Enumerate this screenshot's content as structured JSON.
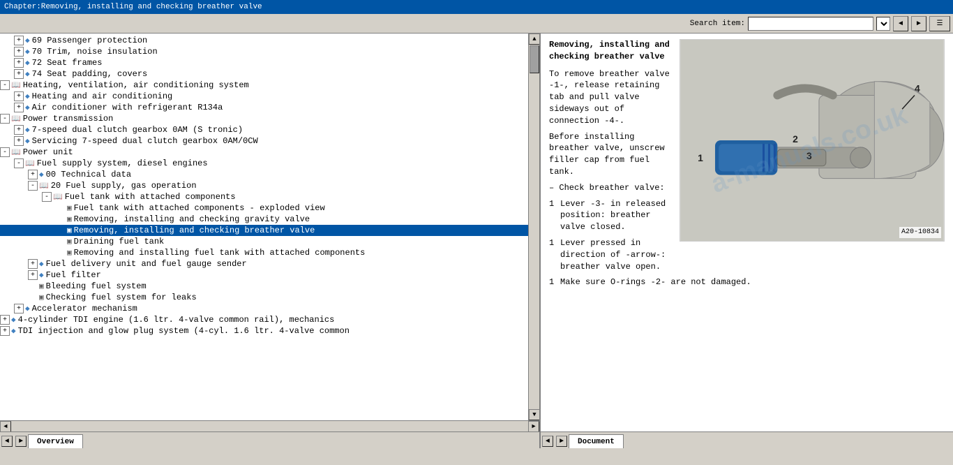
{
  "titleBar": {
    "text": "Chapter:Removing, installing and checking breather valve"
  },
  "toolbar": {
    "searchLabel": "Search item:",
    "searchPlaceholder": ""
  },
  "tabs": {
    "left": {
      "overview": "Overview",
      "nav_prev": "◄",
      "nav_next": "►"
    },
    "right": {
      "document": "Document",
      "nav_prev": "◄",
      "nav_next": "►"
    }
  },
  "tree": {
    "items": [
      {
        "id": 1,
        "indent": "indent1",
        "type": "expandable",
        "icon": "diamond",
        "text": "69 Passenger protection",
        "expanded": true
      },
      {
        "id": 2,
        "indent": "indent1",
        "type": "expandable",
        "icon": "diamond",
        "text": "70 Trim, noise insulation",
        "expanded": true
      },
      {
        "id": 3,
        "indent": "indent1",
        "type": "expandable",
        "icon": "diamond",
        "text": "72 Seat frames",
        "expanded": true
      },
      {
        "id": 4,
        "indent": "indent1",
        "type": "expandable",
        "icon": "diamond",
        "text": "74 Seat padding, covers",
        "expanded": true
      },
      {
        "id": 5,
        "indent": "indent0",
        "type": "expandable-open",
        "icon": "book",
        "text": "Heating, ventilation, air conditioning system",
        "expanded": true
      },
      {
        "id": 6,
        "indent": "indent1",
        "type": "expandable",
        "icon": "diamond",
        "text": "Heating and air conditioning",
        "expanded": true
      },
      {
        "id": 7,
        "indent": "indent1",
        "type": "expandable",
        "icon": "diamond",
        "text": "Air conditioner with refrigerant R134a",
        "expanded": true
      },
      {
        "id": 8,
        "indent": "indent0",
        "type": "expandable-open",
        "icon": "book",
        "text": "Power transmission",
        "expanded": true
      },
      {
        "id": 9,
        "indent": "indent1",
        "type": "expandable",
        "icon": "diamond",
        "text": "7-speed dual clutch gearbox 0AM (S tronic)",
        "expanded": true
      },
      {
        "id": 10,
        "indent": "indent1",
        "type": "expandable",
        "icon": "diamond",
        "text": "Servicing 7-speed dual clutch gearbox 0AM/0CW",
        "expanded": true
      },
      {
        "id": 11,
        "indent": "indent0",
        "type": "expandable-open",
        "icon": "book",
        "text": "Power unit",
        "expanded": true
      },
      {
        "id": 12,
        "indent": "indent1",
        "type": "expandable-open",
        "icon": "book",
        "text": "Fuel supply system, diesel engines",
        "expanded": true
      },
      {
        "id": 13,
        "indent": "indent2",
        "type": "expandable",
        "icon": "diamond",
        "text": "00 Technical data",
        "expanded": true
      },
      {
        "id": 14,
        "indent": "indent2",
        "type": "expandable-open",
        "icon": "book",
        "text": "20 Fuel supply, gas operation",
        "expanded": true
      },
      {
        "id": 15,
        "indent": "indent3",
        "type": "expandable-open",
        "icon": "book",
        "text": "Fuel tank with attached components",
        "expanded": true
      },
      {
        "id": 16,
        "indent": "indent4",
        "type": "page",
        "icon": "page",
        "text": "Fuel tank with attached components - exploded view",
        "expanded": false
      },
      {
        "id": 17,
        "indent": "indent4",
        "type": "page",
        "icon": "page",
        "text": "Removing, installing and checking gravity valve",
        "expanded": false
      },
      {
        "id": 18,
        "indent": "indent4",
        "type": "page",
        "icon": "page",
        "text": "Removing, installing and checking breather valve",
        "expanded": false,
        "selected": true
      },
      {
        "id": 19,
        "indent": "indent4",
        "type": "page",
        "icon": "page",
        "text": "Draining fuel tank",
        "expanded": false
      },
      {
        "id": 20,
        "indent": "indent4",
        "type": "page",
        "icon": "page",
        "text": "Removing and installing fuel tank with attached components",
        "expanded": false
      },
      {
        "id": 21,
        "indent": "indent2",
        "type": "expandable",
        "icon": "diamond",
        "text": "Fuel delivery unit and fuel gauge sender",
        "expanded": true
      },
      {
        "id": 22,
        "indent": "indent2",
        "type": "expandable",
        "icon": "diamond",
        "text": "Fuel filter",
        "expanded": true
      },
      {
        "id": 23,
        "indent": "indent2",
        "type": "page",
        "icon": "page",
        "text": "Bleeding fuel system",
        "expanded": false
      },
      {
        "id": 24,
        "indent": "indent2",
        "type": "page",
        "icon": "page",
        "text": "Checking fuel system for leaks",
        "expanded": false
      },
      {
        "id": 25,
        "indent": "indent1",
        "type": "expandable",
        "icon": "diamond",
        "text": "Accelerator mechanism",
        "expanded": true
      },
      {
        "id": 26,
        "indent": "indent0",
        "type": "expandable",
        "icon": "diamond",
        "text": "4-cylinder TDI engine (1.6 ltr. 4-valve common rail), mechanics",
        "expanded": true
      },
      {
        "id": 27,
        "indent": "indent0",
        "type": "expandable",
        "icon": "diamond",
        "text": "TDI injection and glow plug system (4-cyl. 1.6 ltr. 4-valve common",
        "expanded": true
      }
    ]
  },
  "document": {
    "title": "Removing, installing and checking breather valve",
    "sections": [
      {
        "type": "text",
        "content": "To remove breather valve -1-, release retaining tab and pull valve sideways out of connection -4-."
      },
      {
        "type": "text",
        "content": "Before installing breather valve, unscrew filler cap from fuel tank."
      },
      {
        "type": "bullet",
        "content": "Check breather valve:"
      },
      {
        "type": "numbered",
        "number": "1",
        "content": "Lever -3- in released position: breather valve closed."
      },
      {
        "type": "numbered",
        "number": "1",
        "content": "Lever pressed in direction of -arrow-: breather valve open."
      },
      {
        "type": "numbered",
        "number": "1",
        "content": "Make sure O-rings -2- are not damaged."
      }
    ],
    "imageLabel": "A20-10834",
    "imageNumbers": [
      "1",
      "2",
      "3",
      "4"
    ],
    "watermark": "a-manuals.co.uk"
  }
}
